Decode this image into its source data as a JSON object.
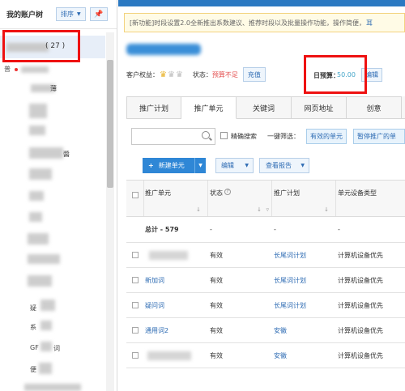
{
  "sidebar": {
    "title": "我的账户树",
    "sort_label": "排序",
    "account_count": "( 27 )",
    "sub_account": "普",
    "tree_items": [
      "薄",
      "醬",
      "疑",
      "系",
      "GF",
      "词",
      "便"
    ],
    "colors": {
      "highlight": "#e7eef8",
      "annotation": "#ee1111"
    }
  },
  "main": {
    "notice": {
      "tag": "[新功能]",
      "text": "时段设置2.0全新推出系数建议、推荐时段以及批量操作功能，操作简便，",
      "link": "耳"
    },
    "info": {
      "rights_label": "客户权益：",
      "status_label": "状态：",
      "status_value": "预算不足",
      "recharge_label": "充值",
      "budget_label": "日预算：",
      "budget_value": "50.00",
      "edit_label": "编辑"
    },
    "tabs": [
      {
        "label": "推广计划",
        "active": false
      },
      {
        "label": "推广单元",
        "active": true
      },
      {
        "label": "关键词",
        "active": false
      },
      {
        "label": "网页地址",
        "active": false
      },
      {
        "label": "创意",
        "active": false
      }
    ],
    "search": {
      "placeholder": ""
    },
    "exact_search_label": "精确搜索",
    "filter": {
      "label": "一键筛选：",
      "valid_units": "有效的单元",
      "paused_units": "暂停推广的单"
    },
    "toolbar": {
      "new_unit": "新建单元",
      "edit": "编辑",
      "report": "查看报告"
    },
    "table": {
      "headers": [
        "推广单元",
        "状态",
        "推广计划",
        "单元设备类型"
      ],
      "total": {
        "label": "总计 - 579",
        "status": "-",
        "plan": "-",
        "device": "-"
      },
      "rows": [
        {
          "unit": "",
          "status": "有效",
          "plan": "长尾词计划",
          "device": "计算机设备优先"
        },
        {
          "unit": "新加词",
          "status": "有效",
          "plan": "长尾词计划",
          "device": "计算机设备优先"
        },
        {
          "unit": "疑问词",
          "status": "有效",
          "plan": "长尾词计划",
          "device": "计算机设备优先"
        },
        {
          "unit": "通用词2",
          "status": "有效",
          "plan": "安徽",
          "device": "计算机设备优先"
        },
        {
          "unit": "",
          "status": "有效",
          "plan": "安徽",
          "device": "计算机设备优先"
        }
      ]
    },
    "colors": {
      "topbar": "#2b79c2",
      "primary_button": "#2f87d6",
      "link": "#2d6bb3",
      "warning": "#e34b4b",
      "budget": "#45a6c9"
    }
  }
}
